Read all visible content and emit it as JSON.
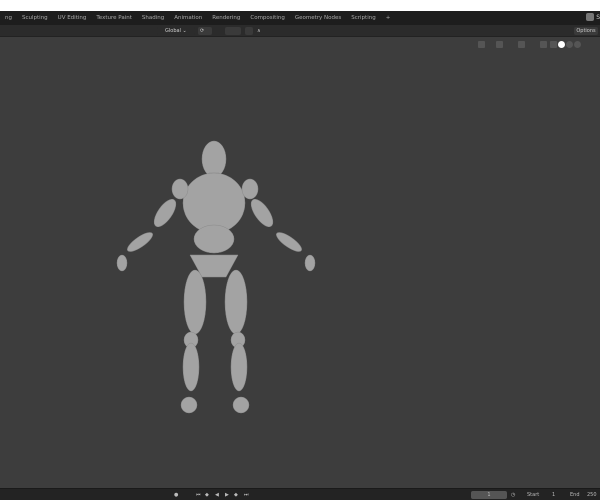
{
  "workspace_tabs": [
    "ng",
    "Sculpting",
    "UV Editing",
    "Texture Paint",
    "Shading",
    "Animation",
    "Rendering",
    "Compositing",
    "Geometry Nodes",
    "Scripting",
    "+"
  ],
  "header": {
    "transform_orientation": "Global",
    "options_label": "Options",
    "scene_label": "S"
  },
  "timeline": {
    "current_frame": "1",
    "start_label": "Start",
    "start_value": "1",
    "end_label": "End",
    "end_value": "250"
  },
  "colors": {
    "viewport": "#3d3d3d",
    "tabbar": "#1d1d1d",
    "model": "#a3a3a3",
    "active_shading": "#ffffff"
  }
}
